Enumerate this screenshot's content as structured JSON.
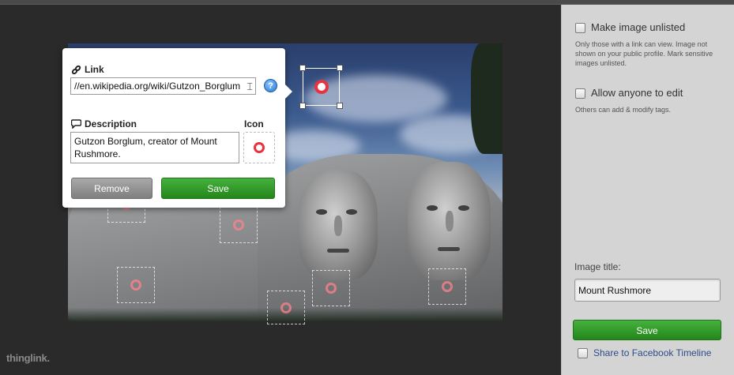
{
  "topbar": {
    "breadcrumb": ""
  },
  "image": {
    "alt": "Mount Rushmore"
  },
  "tag_editor": {
    "link_label": "Link",
    "link_value": "//en.wikipedia.org/wiki/Gutzon_Borglum",
    "description_label": "Description",
    "description_value": "Gutzon Borglum, creator of Mount Rushmore.",
    "icon_label": "Icon",
    "help_icon": "?",
    "remove_label": "Remove",
    "save_label": "Save"
  },
  "brand": {
    "logo_text": "thinglink."
  },
  "sidebar": {
    "unlisted": {
      "label": "Make image unlisted",
      "help": "Only those with a link can view. Image not shown on your public profile. Mark sensitive images unlisted.",
      "checked": false
    },
    "allow_edit": {
      "label": "Allow anyone to edit",
      "help": "Others can add & modify tags.",
      "checked": false
    },
    "title_label": "Image title:",
    "title_value": "Mount Rushmore",
    "save_label": "Save",
    "facebook_label": "Share to Facebook Timeline"
  },
  "colors": {
    "accent_green": "#2f9a27",
    "tag_red": "#e8323f",
    "sidebar_bg": "#d4d4d4",
    "stage_bg": "#2a2a2a"
  },
  "icons": {
    "link": "link-icon",
    "description": "speech-bubble-icon",
    "help": "help-icon",
    "tag": "ring-icon"
  }
}
